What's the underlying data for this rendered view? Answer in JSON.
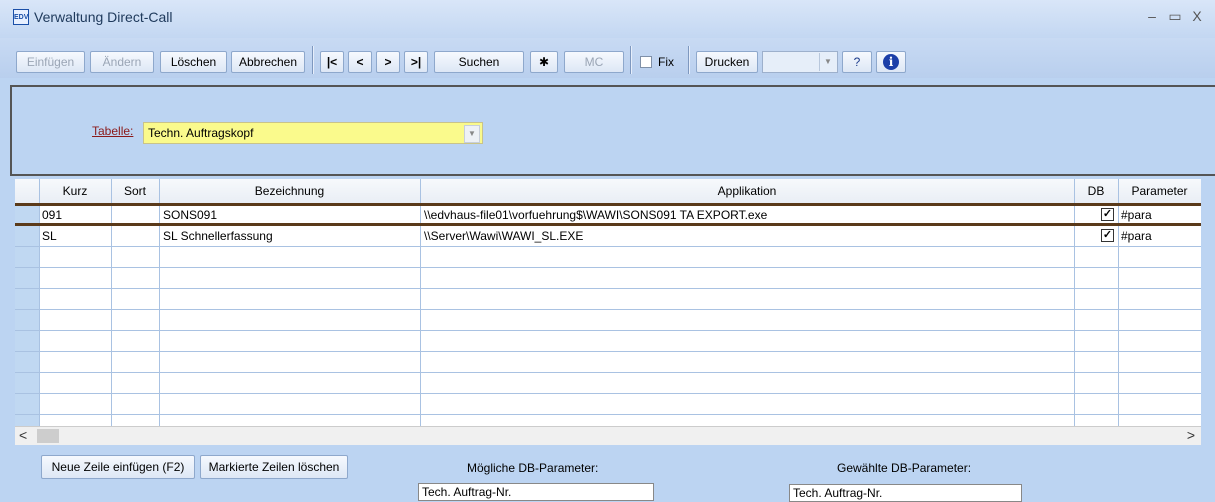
{
  "window": {
    "icon_text": "EDV",
    "title": "Verwaltung Direct-Call",
    "minimize": "–",
    "maximize": "▭",
    "close": "X"
  },
  "toolbar": {
    "einfuegen": "Einfügen",
    "aendern": "Ändern",
    "loeschen": "Löschen",
    "abbrechen": "Abbrechen",
    "first": "|<",
    "prev": "<",
    "next": ">",
    "last": ">|",
    "suchen": "Suchen",
    "star": "✱",
    "mc": "MC",
    "fix": "Fix",
    "drucken": "Drucken",
    "help": "?",
    "info": "i"
  },
  "tabelle": {
    "label": "Tabelle:",
    "value": "Techn. Auftragskopf"
  },
  "grid": {
    "columns": [
      "Kurz",
      "Sort",
      "Bezeichnung",
      "Applikation",
      "DB",
      "Parameter"
    ],
    "rows": [
      {
        "kurz": "091",
        "sort": "",
        "bezeichnung": "SONS091",
        "applikation": "\\\\edvhaus-file01\\vorfuehrung$\\WAWI\\SONS091 TA EXPORT.exe",
        "db": true,
        "parameter": "#para"
      },
      {
        "kurz": "SL",
        "sort": "",
        "bezeichnung": "SL Schnellerfassung",
        "applikation": "\\\\Server\\Wawi\\WAWI_SL.EXE",
        "db": true,
        "parameter": "#para"
      }
    ]
  },
  "scroll": {
    "left": "<",
    "right": ">"
  },
  "bottom": {
    "neue_zeile": "Neue Zeile einfügen (F2)",
    "markierte_loeschen": "Markierte Zeilen löschen",
    "moegliche_label": "Mögliche DB-Parameter:",
    "moegliche_value": "Tech. Auftrag-Nr.",
    "gewaehlte_label": "Gewählte DB-Parameter:",
    "gewaehlte_value": "Tech. Auftrag-Nr."
  },
  "colors": {
    "background": "#bcd4f2",
    "highlight": "#fafa8c",
    "label_red": "#8b1a1a",
    "row_separator": "#5a3a1a"
  }
}
